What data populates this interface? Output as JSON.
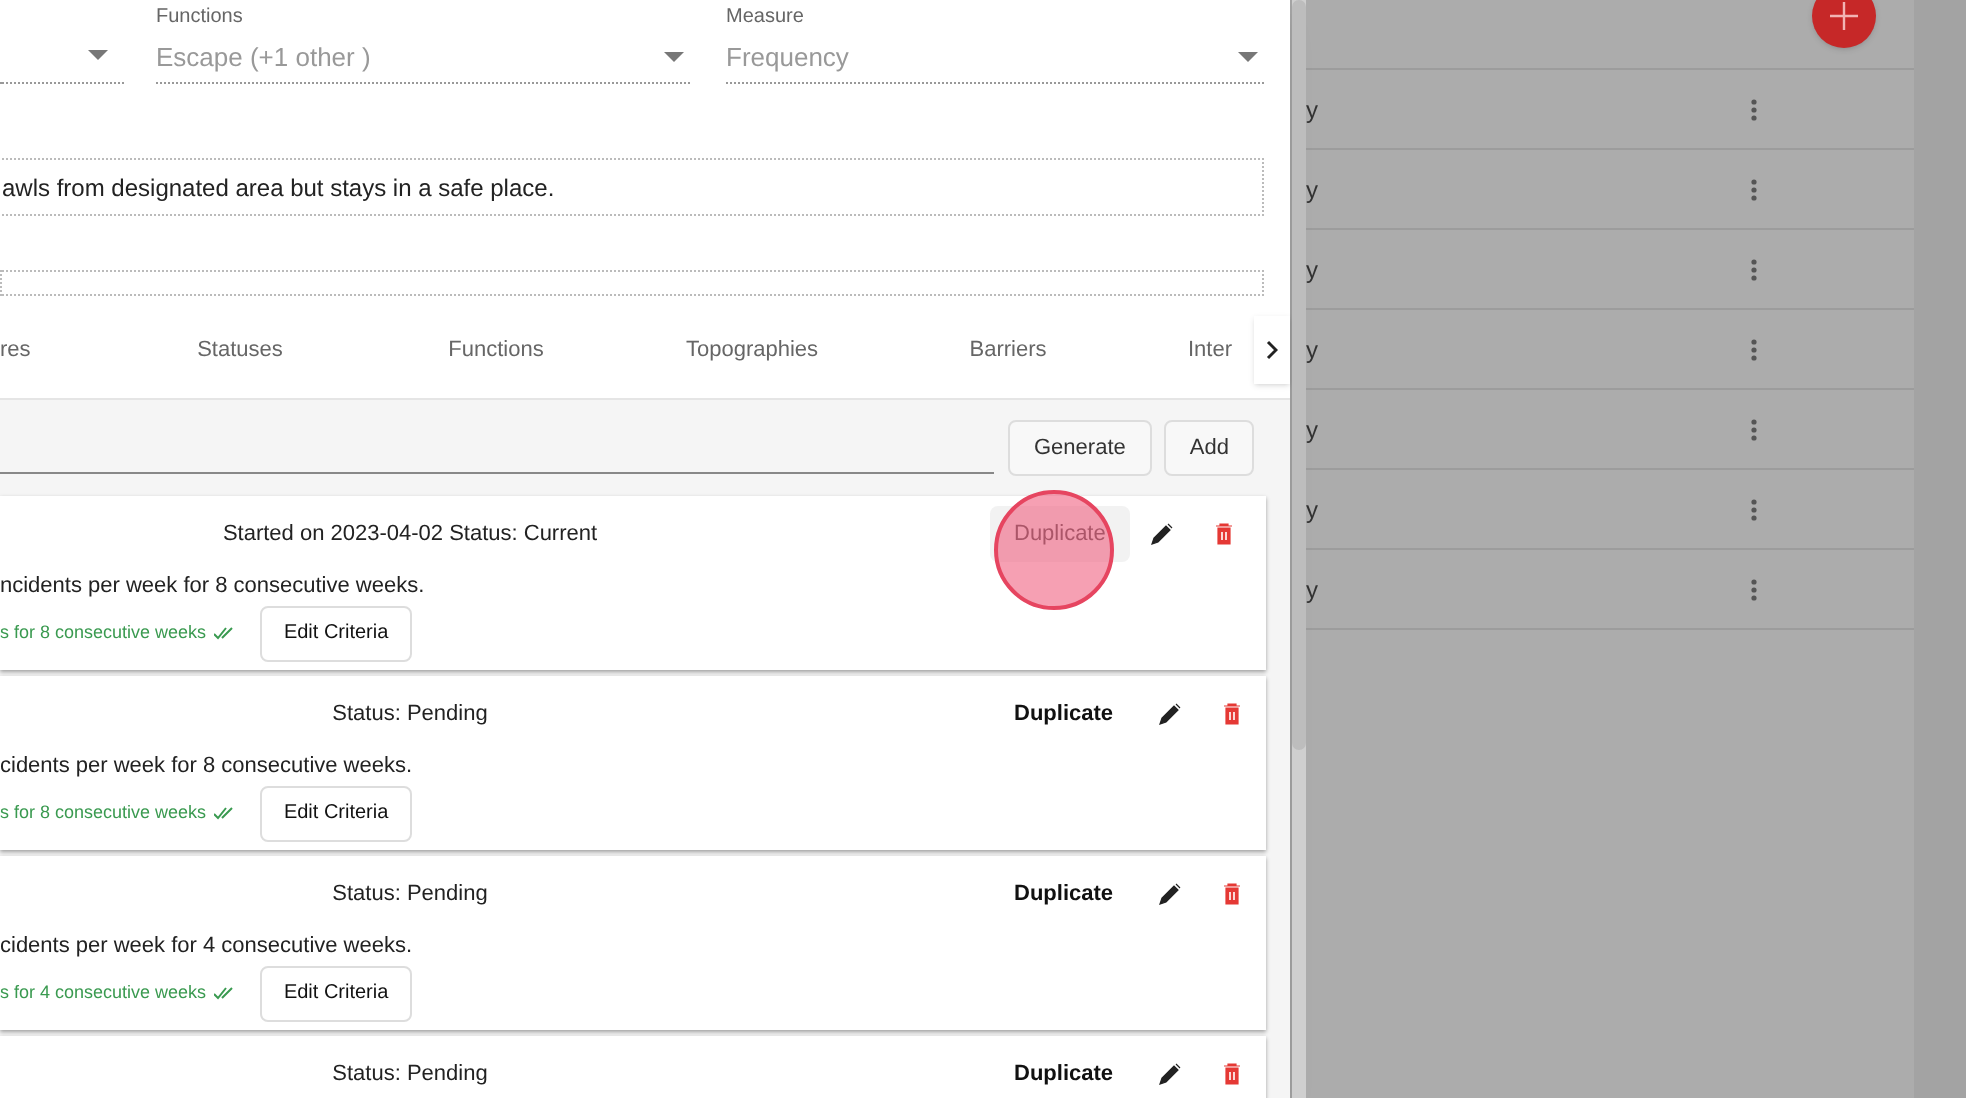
{
  "fields": [
    {
      "label": "Functions",
      "value": "Escape (+1 other )"
    },
    {
      "label": "Measure",
      "value": "Frequency"
    }
  ],
  "description": "awls from designated area but stays in a safe place.",
  "tabs": [
    {
      "label": "res",
      "selected": false
    },
    {
      "label": "Statuses",
      "selected": false
    },
    {
      "label": "Functions",
      "selected": false
    },
    {
      "label": "Topographies",
      "selected": false
    },
    {
      "label": "Barriers",
      "selected": false
    },
    {
      "label": "Inter",
      "selected": false
    }
  ],
  "actions": [
    "Generate",
    "Add"
  ],
  "goals": [
    {
      "status": "Started on 2023-04-02 Status: Current",
      "duplicate": "Duplicate",
      "duplicate_hovered": true,
      "description": "ncidents per week for 8 consecutive weeks.",
      "criteria": "s for 8 consecutive weeks",
      "edit": "Edit Criteria"
    },
    {
      "status": "Status: Pending",
      "duplicate": "Duplicate",
      "duplicate_hovered": false,
      "description": "cidents per week for 8 consecutive weeks.",
      "criteria": "s for 8 consecutive weeks",
      "edit": "Edit Criteria"
    },
    {
      "status": "Status: Pending",
      "duplicate": "Duplicate",
      "duplicate_hovered": false,
      "description": "cidents per week for 4 consecutive weeks.",
      "criteria": "s for 4 consecutive weeks",
      "edit": "Edit Criteria"
    },
    {
      "status": "Status: Pending",
      "duplicate": "Duplicate",
      "duplicate_hovered": false
    }
  ],
  "background_list": {
    "rows": [
      "y",
      "y",
      "y",
      "y",
      "y",
      "y",
      "y"
    ]
  }
}
